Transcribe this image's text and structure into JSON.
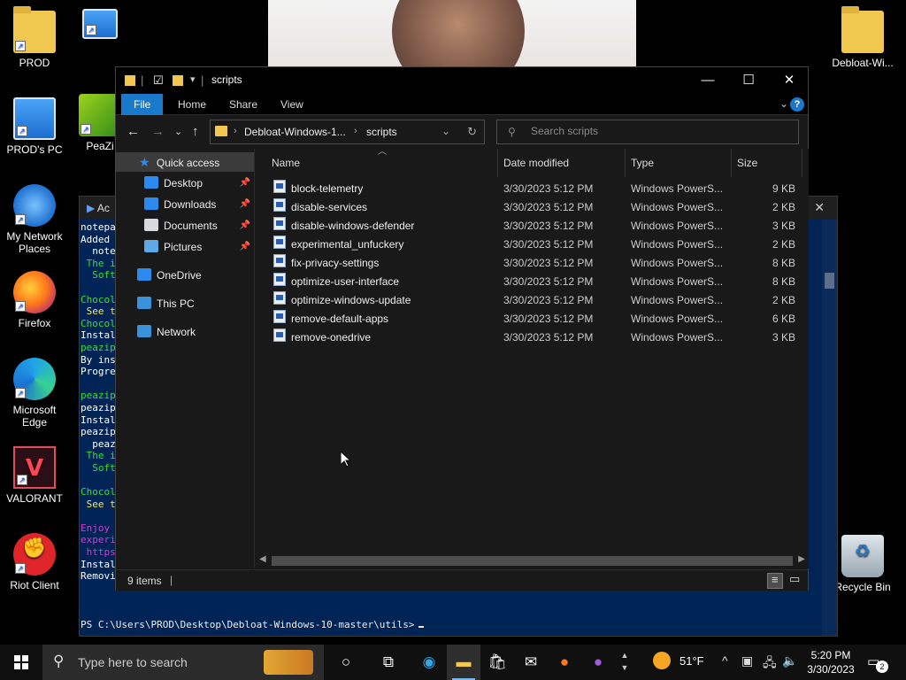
{
  "desktop": {
    "icons": [
      {
        "label": "PROD",
        "icon": "folder-icon"
      },
      {
        "label": "PROD's PC",
        "icon": "computer-icon"
      },
      {
        "label": "My Network Places",
        "icon": "network-icon"
      },
      {
        "label": "Firefox",
        "icon": "firefox-icon"
      },
      {
        "label": "Microsoft Edge",
        "icon": "edge-icon"
      },
      {
        "label": "VALORANT",
        "icon": "valorant-icon"
      },
      {
        "label": "Riot Client",
        "icon": "riot-client-icon"
      },
      {
        "label": "PeaZi",
        "icon": "peazip-icon"
      },
      {
        "label": "Debloat-Wi...",
        "icon": "folder-icon"
      },
      {
        "label": "Recycle Bin",
        "icon": "recycle-bin-icon"
      }
    ]
  },
  "powershell": {
    "title_fragment": "Ac",
    "lines": [
      {
        "text": "notepa",
        "color": "#ffffff"
      },
      {
        "text": "Added ",
        "color": "#ffffff"
      },
      {
        "text": "  note",
        "color": "#ffffff"
      },
      {
        "text": " The i",
        "color": "#3cdc3c"
      },
      {
        "text": "  Soft",
        "color": "#3cdc3c"
      },
      {
        "text": "",
        "color": "#ffffff"
      },
      {
        "text": "Chocol",
        "color": "#3cdc3c"
      },
      {
        "text": " See t",
        "color": "#f0e860"
      },
      {
        "text": "Chocol",
        "color": "#3cdc3c"
      },
      {
        "text": "Instal",
        "color": "#ffffff"
      },
      {
        "text": "peazip",
        "color": "#3cdc3c"
      },
      {
        "text": "By ins",
        "color": "#ffffff"
      },
      {
        "text": "Progre",
        "color": "#ffffff"
      },
      {
        "text": "",
        "color": "#ffffff"
      },
      {
        "text": "peazip",
        "color": "#3cdc3c"
      },
      {
        "text": "peazip",
        "color": "#ffffff"
      },
      {
        "text": "Instal",
        "color": "#ffffff"
      },
      {
        "text": "peazip",
        "color": "#ffffff"
      },
      {
        "text": "  peaz",
        "color": "#ffffff"
      },
      {
        "text": " The i",
        "color": "#3cdc3c"
      },
      {
        "text": "  Soft",
        "color": "#3cdc3c"
      },
      {
        "text": "",
        "color": "#ffffff"
      },
      {
        "text": "Chocol",
        "color": "#3cdc3c"
      },
      {
        "text": " See t",
        "color": "#f0e860"
      },
      {
        "text": "",
        "color": "#ffffff"
      },
      {
        "text": "Enjoy ",
        "color": "#d23cd2"
      },
      {
        "text": "experi",
        "color": "#d23cd2"
      },
      {
        "text": " https",
        "color": "#d23cd2"
      },
      {
        "text": "Instal",
        "color": "#ffffff"
      },
      {
        "text": "Removi",
        "color": "#ffffff"
      }
    ],
    "prompt": "PS C:\\Users\\PROD\\Desktop\\Debloat-Windows-10-master\\utils>"
  },
  "explorer": {
    "title": "scripts",
    "ribbon_tabs": [
      "File",
      "Home",
      "Share",
      "View"
    ],
    "address": {
      "crumbs": [
        "Debloat-Windows-1...",
        "scripts"
      ]
    },
    "search": {
      "placeholder": "Search scripts"
    },
    "nav": {
      "quick_access": "Quick access",
      "pinned": [
        "Desktop",
        "Downloads",
        "Documents",
        "Pictures"
      ],
      "onedrive": "OneDrive",
      "this_pc": "This PC",
      "network": "Network"
    },
    "columns": [
      "Name",
      "Date modified",
      "Type",
      "Size"
    ],
    "files": [
      {
        "name": "block-telemetry",
        "date": "3/30/2023 5:12 PM",
        "type": "Windows PowerS...",
        "size": "9 KB"
      },
      {
        "name": "disable-services",
        "date": "3/30/2023 5:12 PM",
        "type": "Windows PowerS...",
        "size": "2 KB"
      },
      {
        "name": "disable-windows-defender",
        "date": "3/30/2023 5:12 PM",
        "type": "Windows PowerS...",
        "size": "3 KB"
      },
      {
        "name": "experimental_unfuckery",
        "date": "3/30/2023 5:12 PM",
        "type": "Windows PowerS...",
        "size": "2 KB"
      },
      {
        "name": "fix-privacy-settings",
        "date": "3/30/2023 5:12 PM",
        "type": "Windows PowerS...",
        "size": "8 KB"
      },
      {
        "name": "optimize-user-interface",
        "date": "3/30/2023 5:12 PM",
        "type": "Windows PowerS...",
        "size": "8 KB"
      },
      {
        "name": "optimize-windows-update",
        "date": "3/30/2023 5:12 PM",
        "type": "Windows PowerS...",
        "size": "2 KB"
      },
      {
        "name": "remove-default-apps",
        "date": "3/30/2023 5:12 PM",
        "type": "Windows PowerS...",
        "size": "6 KB"
      },
      {
        "name": "remove-onedrive",
        "date": "3/30/2023 5:12 PM",
        "type": "Windows PowerS...",
        "size": "3 KB"
      }
    ],
    "status": {
      "item_count": "9 items"
    }
  },
  "taskbar": {
    "search_placeholder": "Type here to search",
    "weather": "51°F",
    "time": "5:20 PM",
    "date": "3/30/2023",
    "notification_count": "2"
  }
}
